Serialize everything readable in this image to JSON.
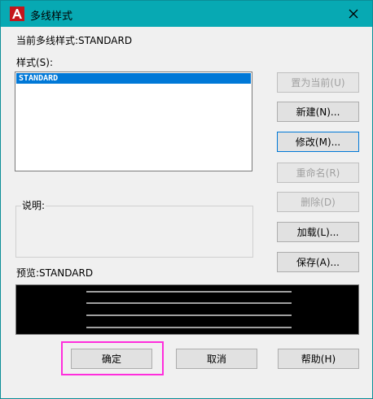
{
  "window": {
    "title": "多线样式",
    "accent_color": "#07a9b3",
    "app_icon": "autocad-a-icon",
    "close_icon": "close-icon"
  },
  "current_style": {
    "label": "当前多线样式:",
    "value": "STANDARD"
  },
  "styles": {
    "label": "样式(S):",
    "items": [
      "STANDARD"
    ],
    "selected": "STANDARD"
  },
  "description": {
    "label": "说明:"
  },
  "preview": {
    "label": "预览:STANDARD"
  },
  "side_buttons": {
    "set_current": "置为当前(U)",
    "new": "新建(N)...",
    "modify": "修改(M)...",
    "rename": "重命名(R)",
    "delete": "删除(D)",
    "load": "加载(L)...",
    "save": "保存(A)..."
  },
  "bottom_buttons": {
    "ok": "确定",
    "cancel": "取消",
    "help": "帮助(H)"
  }
}
